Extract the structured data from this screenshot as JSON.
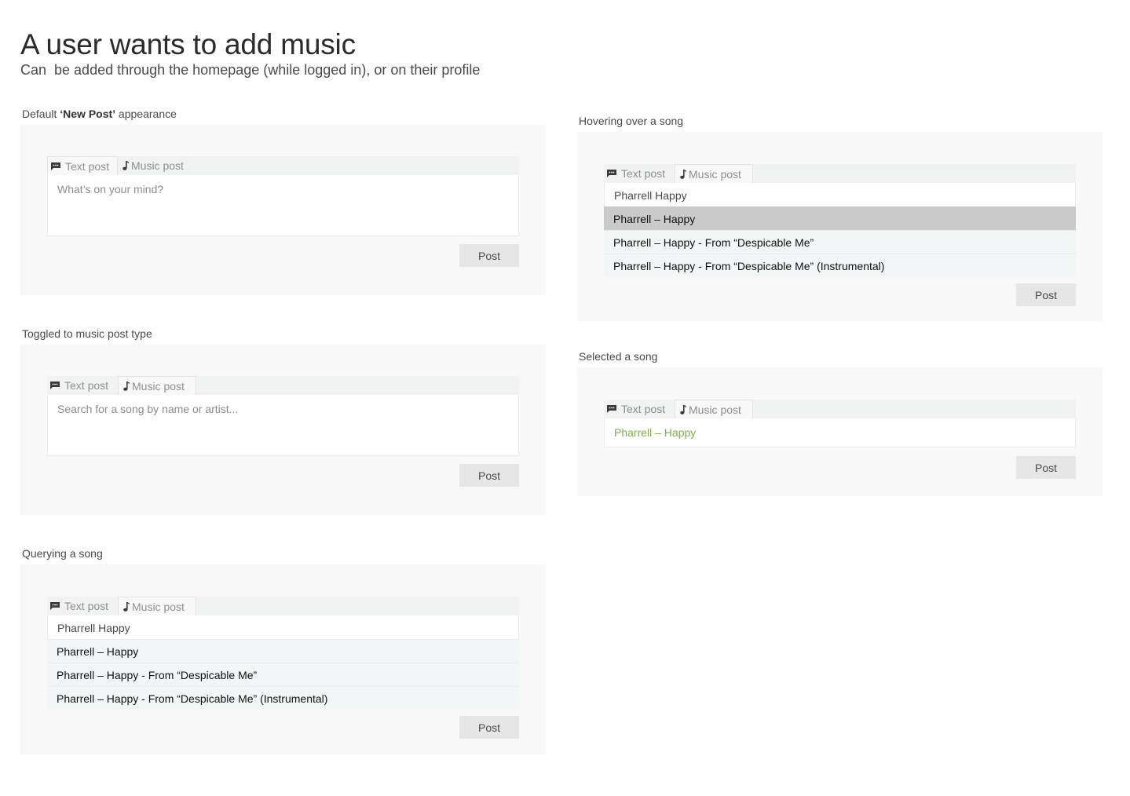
{
  "header": {
    "title": "A user wants to add music",
    "subtitle": "Can  be added through the homepage (while logged in), or on their profile"
  },
  "tabs": {
    "text_post": "Text post",
    "music_post": "Music post"
  },
  "post_button_label": "Post",
  "sections": {
    "default": {
      "label_prefix": "Default ",
      "label_bold": "‘New Post’",
      "label_suffix": " appearance",
      "placeholder": "What’s on your mind?"
    },
    "toggled": {
      "label": "Toggled to music post type",
      "placeholder": "Search for a song by name or artist..."
    },
    "querying": {
      "label": "Querying a song",
      "query": "Pharrell Happy",
      "results": [
        "Pharrell – Happy",
        "Pharrell – Happy - From “Despicable Me”",
        "Pharrell – Happy - From “Despicable Me” (Instrumental)"
      ]
    },
    "hovering": {
      "label": "Hovering over a song",
      "query": "Pharrell Happy",
      "results": [
        "Pharrell – Happy",
        "Pharrell – Happy - From “Despicable Me”",
        "Pharrell – Happy - From “Despicable Me” (Instrumental)"
      ],
      "hovered_index": 0
    },
    "selected": {
      "label": "Selected a song",
      "selected_song": "Pharrell – Happy"
    }
  },
  "icons": {
    "text_post": "chat-bubble-icon",
    "music_post": "music-note-icon"
  },
  "colors": {
    "selected_song": "#7cb342",
    "hover_row": "#cacaca",
    "panel_background": "#f8f8f8"
  }
}
